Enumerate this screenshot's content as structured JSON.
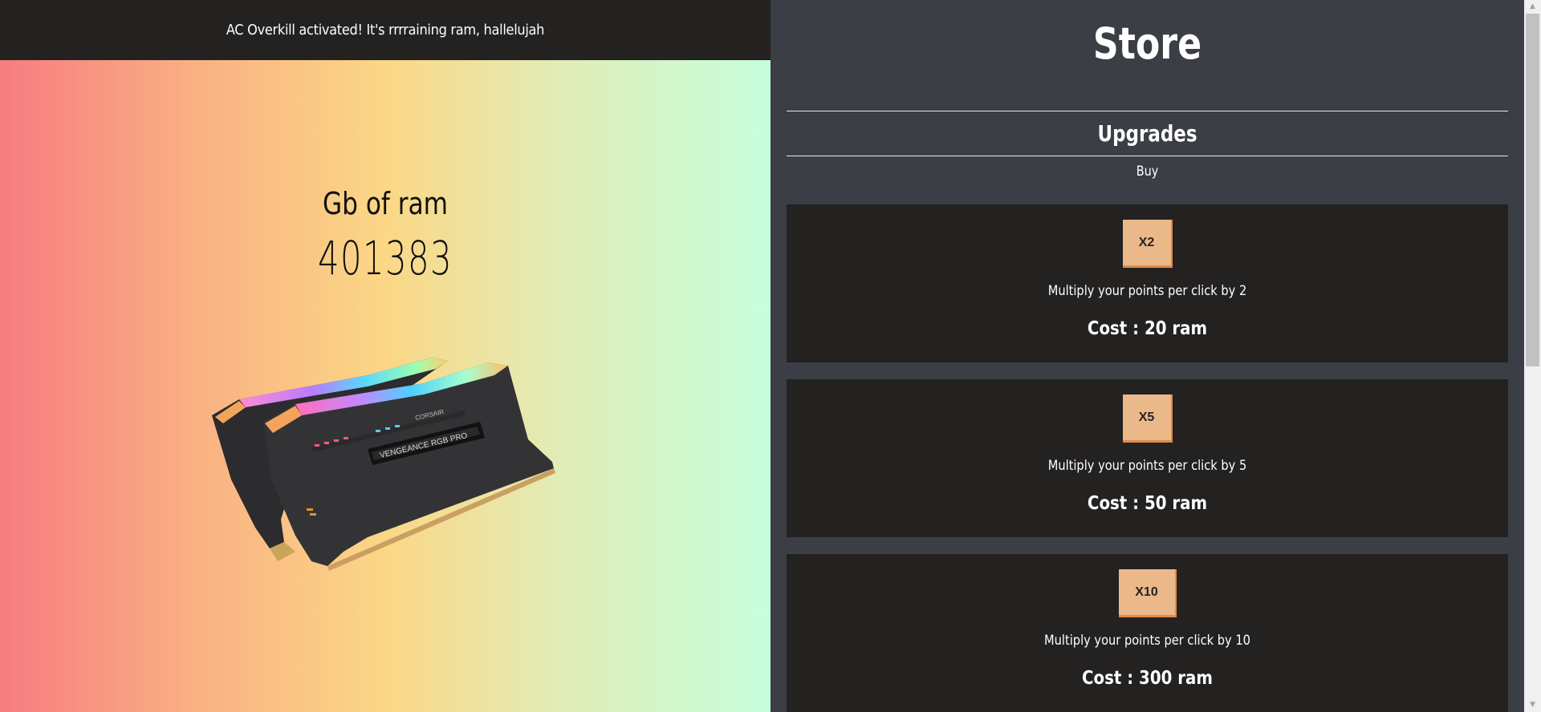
{
  "banner": {
    "message": "AC Overkill activated! It's rrrraining ram, hallelujah"
  },
  "counter": {
    "label": "Gb of ram",
    "value": "401383"
  },
  "ram": {
    "icon": "ram-stick-image",
    "brand": "CORSAIR",
    "model": "VENGEANCE RGB PRO"
  },
  "store": {
    "title": "Store",
    "section_title": "Upgrades",
    "buy_label": "Buy",
    "upgrades": [
      {
        "button": "X2",
        "description": "Multiply your points per click by 2",
        "cost": "Cost : 20 ram"
      },
      {
        "button": "X5",
        "description": "Multiply your points per click by 5",
        "cost": "Cost : 50 ram"
      },
      {
        "button": "X10",
        "description": "Multiply your points per click by 10",
        "cost": "Cost : 300 ram"
      }
    ]
  },
  "scrollbar": {
    "up_icon": "chevron-up-icon",
    "down_icon": "chevron-down-icon"
  },
  "colors": {
    "banner_bg": "#242121",
    "store_bg": "#3b3e44",
    "card_bg": "#242121",
    "button_bg": "#eab889",
    "button_border": "#e08b4d",
    "gradient_start": "#f77c80",
    "gradient_mid": "#fbd786",
    "gradient_end": "#c6ffdd"
  }
}
